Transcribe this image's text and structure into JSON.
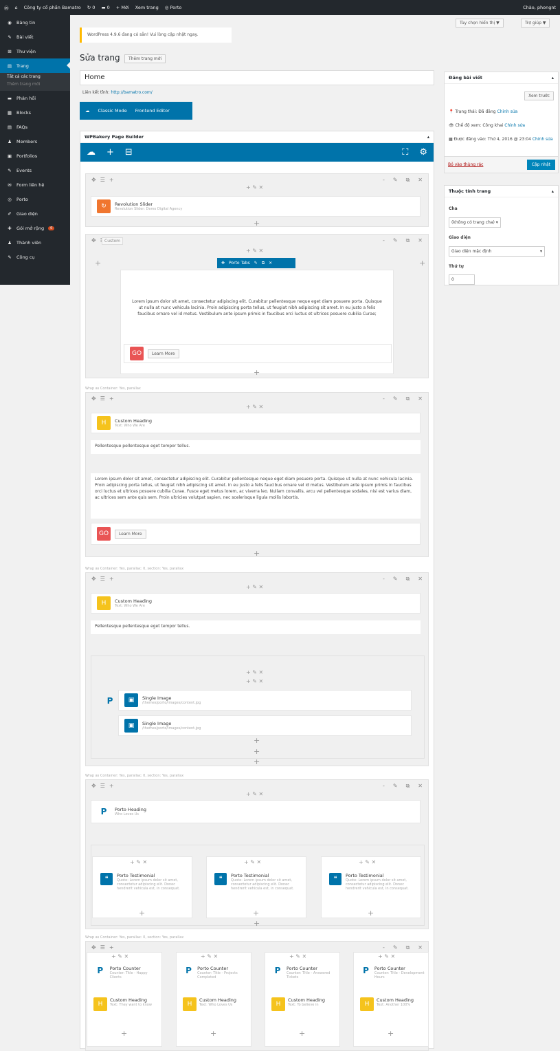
{
  "adminbar": {
    "site": "Công ty cổ phần Bamatro",
    "comments": "0",
    "updates": "0",
    "new": "Mới",
    "view": "Xem trang",
    "porto": "Porto",
    "greeting": "Chào, phongnt"
  },
  "menu": [
    {
      "label": "Bảng tin",
      "icon": "dashboard-icon"
    },
    {
      "label": "Bài viết",
      "icon": "pin-icon"
    },
    {
      "label": "Thư viện",
      "icon": "media-icon"
    },
    {
      "label": "Trang",
      "icon": "page-icon"
    },
    {
      "label": "Phản hồi",
      "icon": "comment-icon"
    },
    {
      "label": "Blocks",
      "icon": "block-icon"
    },
    {
      "label": "FAQs",
      "icon": "faq-icon"
    },
    {
      "label": "Members",
      "icon": "user-icon"
    },
    {
      "label": "Portfolios",
      "icon": "portfolio-icon"
    },
    {
      "label": "Events",
      "icon": "pin-icon"
    },
    {
      "label": "Form liên hệ",
      "icon": "mail-icon"
    },
    {
      "label": "Porto",
      "icon": "porto-icon"
    },
    {
      "label": "Giao diện",
      "icon": "brush-icon"
    },
    {
      "label": "Gói mở rộng",
      "icon": "plugin-icon",
      "badge": "6"
    },
    {
      "label": "Thành viên",
      "icon": "user-icon"
    },
    {
      "label": "Công cụ",
      "icon": "tool-icon"
    }
  ],
  "submenu": [
    "Tất cả các trang",
    "Thêm trang mới"
  ],
  "screen_options": "Tùy chọn hiển thị ▼",
  "help": "Trợ giúp ▼",
  "notice": "WordPress 4.9.6 đang có sẵn! Vui lòng cập nhật ngay.",
  "page_heading": "Sửa trang",
  "add_new": "Thêm trang mới",
  "title_value": "Home",
  "permalink_label": "Liên kết tĩnh:",
  "permalink": "http://bamatro.com/",
  "classic_mode": "Classic Mode",
  "frontend_editor": "Frontend Editor",
  "builder_title": "WPBakery Page Builder",
  "publish": {
    "title": "Đăng bài viết",
    "preview": "Xem trước",
    "status": "Trạng thái: Đã đăng",
    "edit": "Chỉnh sửa",
    "visibility": "Chế độ xem: Công khai",
    "edit2": "Chỉnh sửa",
    "published": "Được đăng vào: Thứ 4, 2016 @ 23:04",
    "edit3": "Chỉnh sửa",
    "trash": "Bỏ vào thùng rác",
    "update": "Cập nhật"
  },
  "attributes": {
    "title": "Thuộc tính trang",
    "parent_label": "Cha",
    "parent_value": "(không có trang cha)",
    "template_label": "Giao diện",
    "template_value": "Giao diện mặc định",
    "order_label": "Thứ tự",
    "order_value": "0"
  },
  "elements": {
    "rev_slider": "Revolution Slider",
    "rev_sub": "Revolution Slider: Demo Digital Agency",
    "custom": "Custom",
    "porto_tabs": "Porto Tabs",
    "lorem": "Lorem ipsum dolor sit amet, consectetur adipiscing elit. Curabitur pellentesque neque eget diam posuere porta. Quisque ut nulla at nunc vehicula lacinia. Proin adipiscing porta tellus, ut feugiat nibh adipiscing sit amet. In eu justo a felis faucibus ornare vel id metus. Vestibulum ante ipsum primis in faucibus orci luctus et ultrices posuere cubilia Curae;",
    "go": "GO",
    "learn_more": "Learn More",
    "wrap": "Wrap as Container: Yes, parallax",
    "custom_heading": "Custom Heading",
    "ch_sub1": "Text: Who We Are",
    "ch_sub2": "Text: Who We Are",
    "pellentesque": "Pellentesque pellentesque eget tempor tellus.",
    "lorem2": "Lorem ipsum dolor sit amet, consectetur adipiscing elit. Curabitur pellentesque neque eget diam posuere porta. Quisque ut nulla at nunc vehicula lacinia. Proin adipiscing porta tellus, ut feugiat nibh adipiscing sit amet. In eu justo a felis faucibus ornare vel id metus. Vestibulum ante ipsum primis in faucibus orci luctus et ultrices posuere cubilia Curae. Fusce eget metus lorem, ac viverra leo. Nullam convallis, arcu vel pellentesque sodales, nisi est varius diam, ac ultrices sem ante quis sem. Proin ultricies volutpat sapien, nec scelerisque ligula mollis lobortis.",
    "wrap2": "Wrap as Container: Yes, parallax: 0, section: Yes, parallax",
    "single_image": "Single Image",
    "si_sub": "/themes/porto/images/content.jpg",
    "porto_heading": "Porto Heading",
    "ph_sub": "Who Loves Us",
    "testimonial": "Porto Testimonial",
    "t_sub": "Quote: Lorem ipsum dolor sit amet, consectetur adipiscing elit. Donec hendrerit vehicula est, in consequat.",
    "counter": "Porto Counter",
    "counter_subs": [
      "Counter: Title - Happy Clients",
      "Counter: Title - Projects Completed",
      "Counter: Title - Answered Tickets",
      "Counter: Title - Development Hours"
    ],
    "ch_subs": [
      "Text: They want to know",
      "Text: Who Loves Us",
      "Text: To believe in",
      "Text: Another 100%"
    ]
  }
}
